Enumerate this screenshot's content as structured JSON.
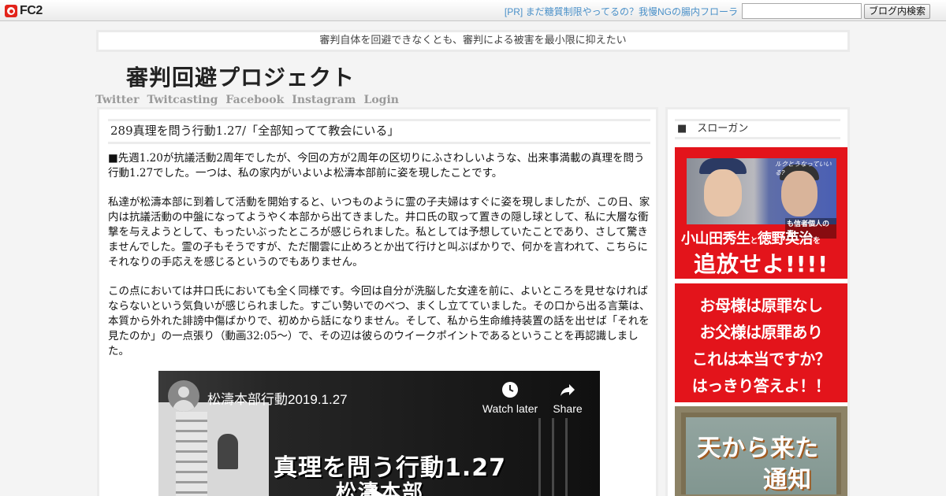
{
  "fc2bar": {
    "logo_text": "FC2",
    "pr_link": "[PR] まだ糖質制限やってるの？我慢NGの腸内フローラ",
    "search_placeholder": "",
    "search_button": "ブログ内検索"
  },
  "header": {
    "tagline": "審判自体を回避できなくとも、審判による被害を最小限に抑えたい",
    "blog_title": "審判回避プロジェクト",
    "nav": [
      "Twitter",
      "Twitcasting",
      "Facebook",
      "Instagram",
      "Login"
    ]
  },
  "entry": {
    "title": "289真理を問う行動1.27/「全部知ってて教会にいる」",
    "paragraphs": [
      "■先週1.20が抗議活動2周年でしたが、今回の方が2周年の区切りにふさわしいような、出来事満載の真理を問う行動1.27でした。一つは、私の家内がいよいよ松濤本部前に姿を現したことです。",
      "私達が松濤本部に到着して活動を開始すると、いつものように霊の子夫婦はすぐに姿を現しましたが、この日、家内は抗議活動の中盤になってようやく本部から出てきました。井口氏の取って置きの隠し球として、私に大層な衝撃を与えようとして、もったいぶったところが感じられました。私としては予想していたことであり、さして驚きませんでした。霊の子もそうですが、ただ闇雲に止めろとか出て行けと叫ぶばかりで、何かを言われて、こちらにそれなりの手応えを感じるというのでもありません。",
      "この点においては井口氏においても全く同様です。今回は自分が洗脳した女達を前に、よいところを見せなければならないという気負いが感じられました。すごい勢いでのべつ、まくし立てていました。その口から出る言葉は、本質から外れた誹謗中傷ばかりで、初めから話になりません。そして、私から生命維持装置の話を出せば「それを見たのか」の一点張り（動画32:05〜）で、その辺は彼らのウイークポイントであるということを再認識しました。"
    ],
    "video": {
      "title": "松濤本部行動2019.1.27",
      "watch_later": "Watch later",
      "share": "Share",
      "overlay_line1": "真理を問う行動1.27",
      "overlay_line2": "松濤本部"
    }
  },
  "sidebar": {
    "section_title": "■　スローガン",
    "banner1": {
      "tag": "ルクとうなっていいる?",
      "sub": "も信者個人の責",
      "name1": "小山田秀生",
      "connector": "と",
      "name2": "徳野英治",
      "particle": "を",
      "slogan": "追放せよ!!!!"
    },
    "banner2": {
      "lines": [
        "お母様は原罪なし",
        "お父様は原罪あり",
        "これは本当ですか？",
        "はっきり答えよ！！"
      ]
    },
    "banner3": {
      "line1": "天から来た",
      "line2": "通知"
    }
  }
}
